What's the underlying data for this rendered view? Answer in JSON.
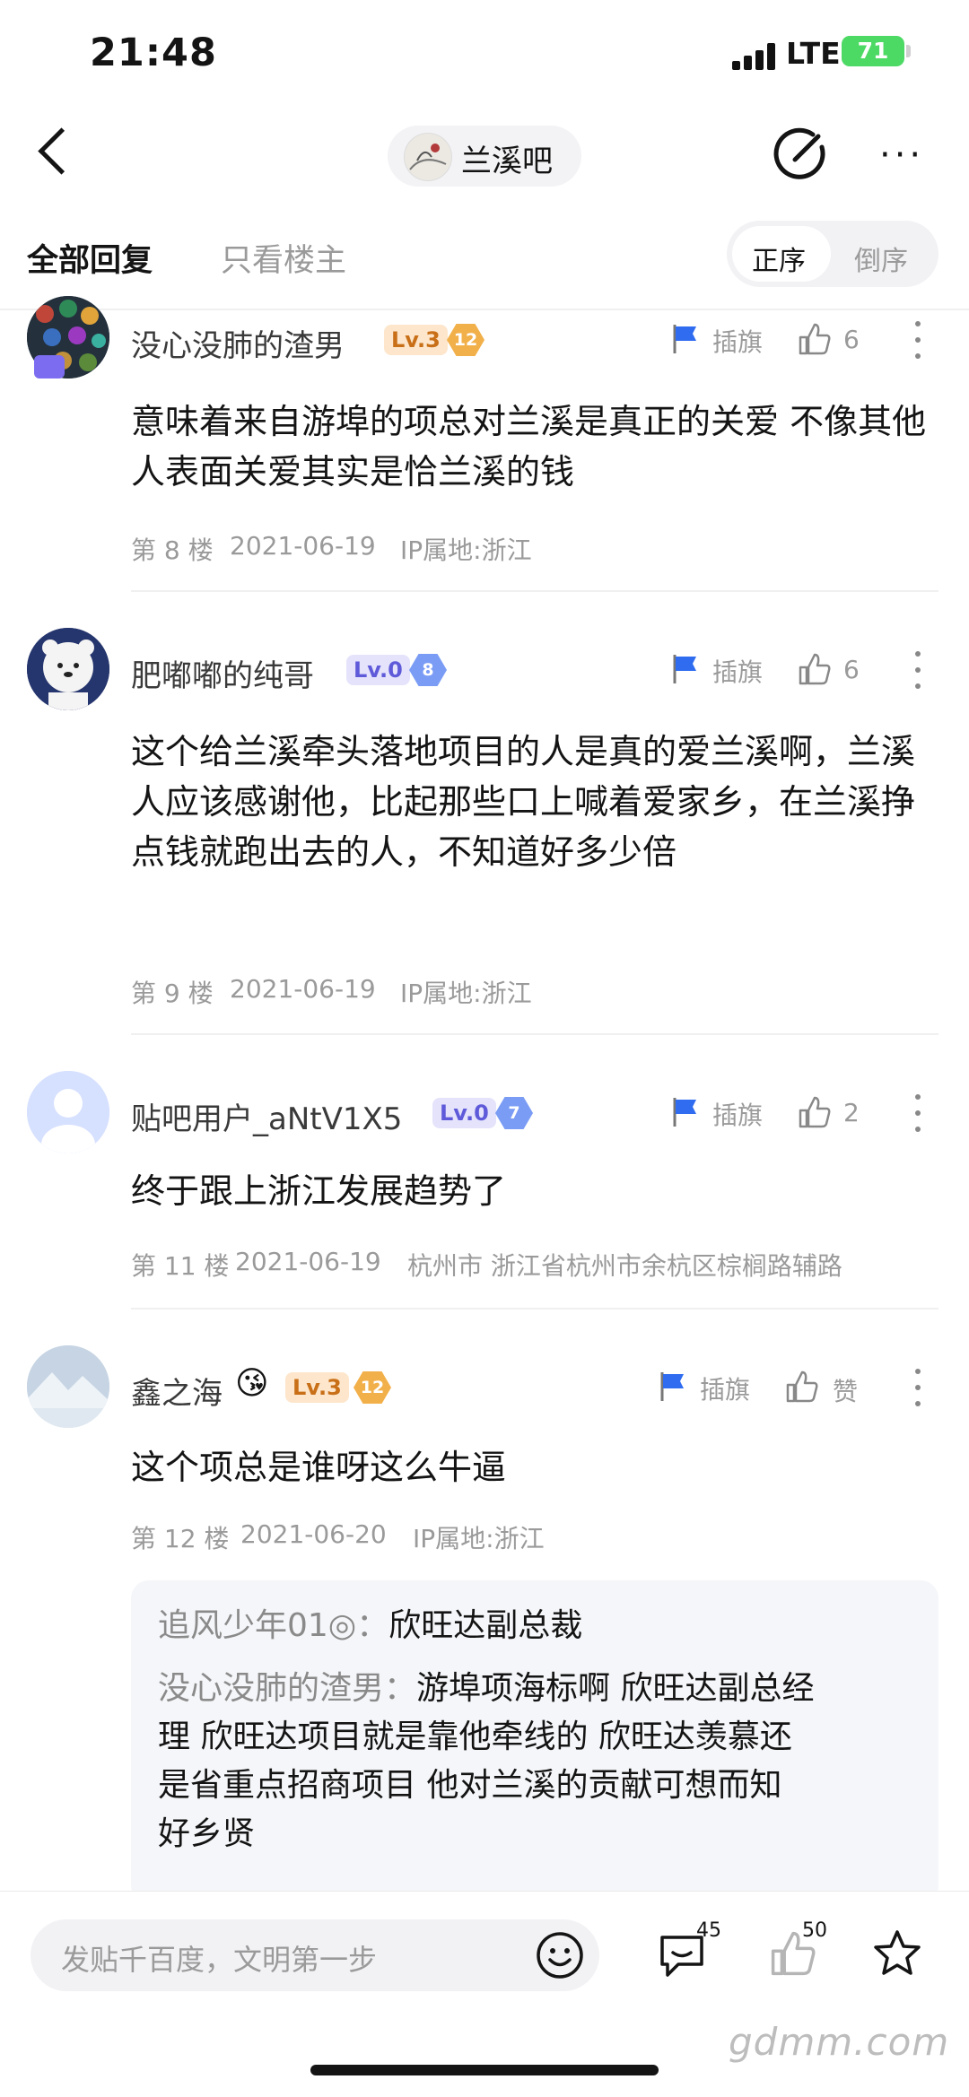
{
  "status_bar": {
    "time": "21:48",
    "network": "LTE",
    "battery": "71"
  },
  "nav": {
    "forum_name": "兰溪吧"
  },
  "tabs": {
    "all": "全部回复",
    "lz_only": "只看楼主",
    "sort_asc": "正序",
    "sort_desc": "倒序"
  },
  "posts": [
    {
      "username": "没心没肺的渣男",
      "level": "Lv.3",
      "badge": "12",
      "flag_label": "插旗",
      "likes": "6",
      "content": "意味着来自游埠的项总对兰溪是真正的关爱 不像其他人表面关爱其实是恰兰溪的钱",
      "floor": "第 8 楼",
      "date": "2021-06-19",
      "location": "IP属地:浙江"
    },
    {
      "username": "肥嘟嘟的纯哥",
      "level": "Lv.0",
      "badge": "8",
      "flag_label": "插旗",
      "likes": "6",
      "content": "这个给兰溪牵头落地项目的人是真的爱兰溪啊，兰溪人应该感谢他，比起那些口上喊着爱家乡，在兰溪挣点钱就跑出去的人，不知道好多少倍",
      "floor": "第 9 楼",
      "date": "2021-06-19",
      "location": "IP属地:浙江"
    },
    {
      "username": "贴吧用户_aNtV1X5",
      "level": "Lv.0",
      "badge": "7",
      "flag_label": "插旗",
      "likes": "2",
      "content": "终于跟上浙江发展趋势了",
      "floor": "第 11 楼",
      "date": "2021-06-19",
      "location": "杭州市 浙江省杭州市余杭区棕榈路辅路"
    },
    {
      "username": "鑫之海",
      "emoji": "😘",
      "level": "Lv.3",
      "badge": "12",
      "flag_label": "插旗",
      "likes": "赞",
      "content": "这个项总是谁呀这么牛逼",
      "floor": "第 12 楼",
      "date": "2021-06-20",
      "location": "IP属地:浙江"
    }
  ],
  "quote": {
    "line1_name": "追风少年01◎：",
    "line1_text": "欣旺达副总裁",
    "line2_name": "没心没肺的渣男：",
    "line2_text": "游埠项海标啊 欣旺达副总经",
    "line3": "理 欣旺达项目就是靠他牵线的 欣旺达羡慕还",
    "line4": "是省重点招商项目 他对兰溪的贡献可想而知",
    "line5": "好乡贤"
  },
  "bottom": {
    "input_placeholder": "发贴千百度，文明第一步",
    "comment_count": "45",
    "like_count": "50"
  },
  "watermark": "gdmm.com",
  "colors": {
    "accent_blue": "#2f6cf0",
    "level_orange": "#c86f17",
    "level_purple": "#5e5ad9"
  }
}
